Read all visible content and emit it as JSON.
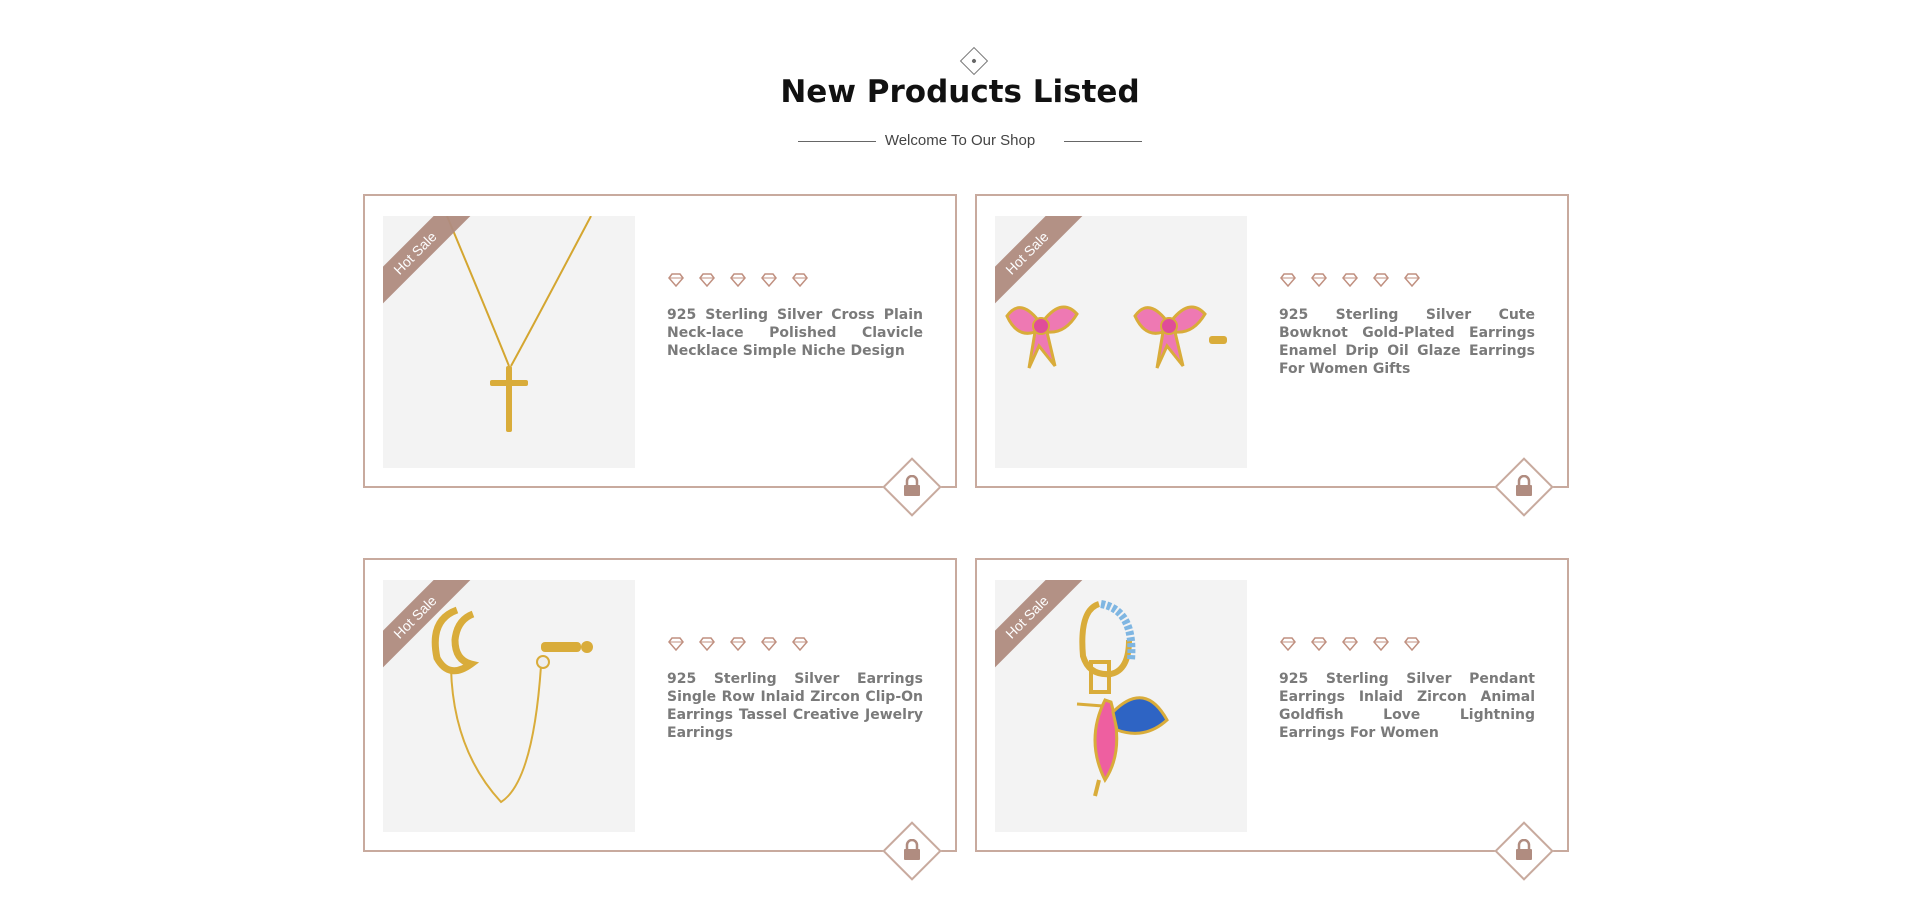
{
  "section": {
    "title": "New Products Listed",
    "subtitle": "Welcome To Our Shop"
  },
  "colors": {
    "accent": "#c8aa9e",
    "ribbon": "#b08c80",
    "text": "#7a7a7a"
  },
  "products": [
    {
      "badge": "Hot Sale",
      "name": "925 Sterling Silver Cross Plain Neck-lace Polished Clavicle Necklace Simple Niche Design",
      "rating_icons": 5,
      "image": "cross-necklace"
    },
    {
      "badge": "Hot Sale",
      "name": "925 Sterling Silver Cute Bowknot Gold-Plated Earrings Enamel Drip Oil Glaze Earrings For Women Gifts",
      "rating_icons": 5,
      "image": "pink-bow-earrings"
    },
    {
      "badge": "Hot Sale",
      "name": "925 Sterling Silver Earrings Single Row Inlaid Zircon Clip-On Earrings Tassel Creative Jewelry Earrings",
      "rating_icons": 5,
      "image": "chain-clip-earrings"
    },
    {
      "badge": "Hot Sale",
      "name": "925 Sterling Silver Pendant Earrings Inlaid Zircon Animal Goldfish Love Lightning Earrings For Women",
      "rating_icons": 5,
      "image": "hummingbird-earring"
    }
  ],
  "icons": {
    "rating": "diamond-icon",
    "cart": "lock-bag-icon",
    "header": "diamond-ornament-icon"
  }
}
